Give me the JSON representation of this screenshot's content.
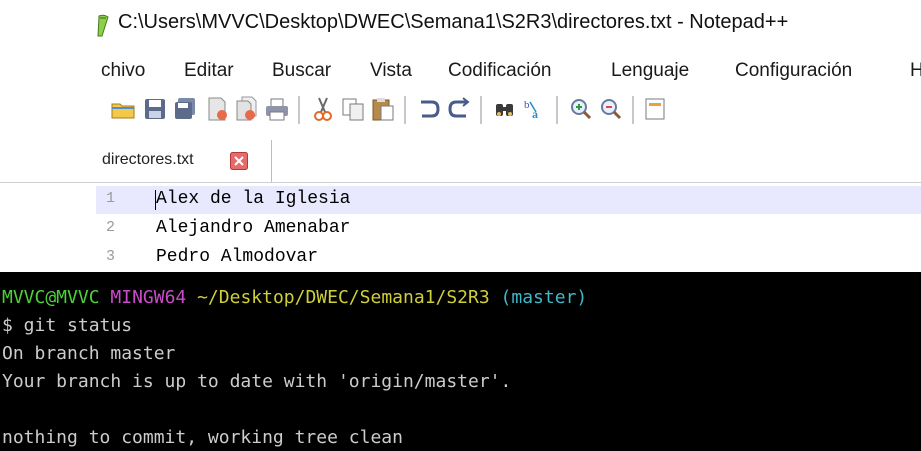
{
  "window": {
    "title": "C:\\Users\\MVVC\\Desktop\\DWEC\\Semana1\\S2R3\\directores.txt - Notepad++",
    "icon": "notepadpp-icon"
  },
  "menu": {
    "items": [
      "chivo",
      "Editar",
      "Buscar",
      "Vista",
      "Codificación",
      "Lenguaje",
      "Configuración",
      "H"
    ]
  },
  "toolbar": {
    "icons": [
      "new-file-icon",
      "open-folder-icon",
      "save-icon",
      "save-all-icon",
      "close-icon",
      "close-all-icon",
      "print-icon",
      "cut-icon",
      "copy-icon",
      "paste-icon",
      "undo-icon",
      "redo-icon",
      "find-icon",
      "replace-icon",
      "zoom-in-icon",
      "zoom-out-icon",
      "sync-scroll-icon"
    ]
  },
  "tab": {
    "label": "directores.txt",
    "close_color": "#e14f4f"
  },
  "editor": {
    "lines": [
      {
        "number": "1",
        "text": "Alex de la Iglesia"
      },
      {
        "number": "2",
        "text": "Alejandro Amenabar"
      },
      {
        "number": "3",
        "text": "Pedro Almodovar"
      }
    ],
    "current_line_color": "#e8e8ff"
  },
  "terminal": {
    "prompt_user": "MVVC@MVVC",
    "prompt_env": "MINGW64",
    "prompt_path": "~/Desktop/DWEC/Semana1/S2R3",
    "prompt_branch": "(master)",
    "command": "$ git status",
    "output": [
      "On branch master",
      "Your branch is up to date with 'origin/master'.",
      "",
      "nothing to commit, working tree clean"
    ],
    "colors": {
      "user": "#4fcf3a",
      "env": "#c94bc9",
      "path": "#cfcf3a",
      "branch": "#3fb8c8"
    }
  }
}
